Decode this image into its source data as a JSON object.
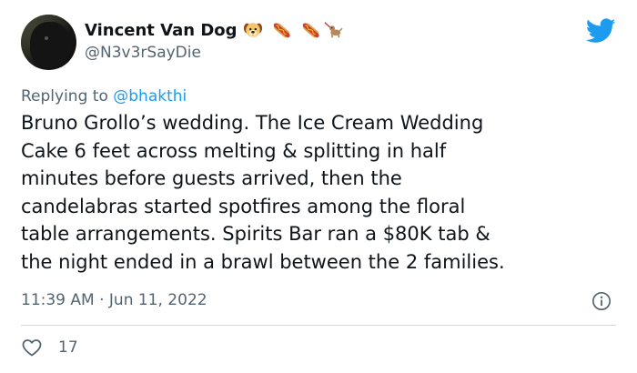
{
  "author": {
    "display_name": "Vincent Van Dog",
    "handle": "@N3v3rSayDie",
    "name_emojis": [
      "dog-face-emoji",
      "hotdog-emoji",
      "hotdog-emoji",
      "dog-on-leash-emoji"
    ]
  },
  "reply": {
    "prefix": "Replying to ",
    "mention": "@bhakthi"
  },
  "tweet": {
    "lines": [
      "Bruno Grollo’s wedding. The Ice Cream Wedding",
      "Cake 6 feet across melting & splitting in half",
      "minutes before guests arrived, then the",
      "candelabras started spotfires among the floral",
      "table arrangements. Spirits Bar ran a $80K tab &",
      "the night ended in a brawl between the 2 families."
    ],
    "timestamp": "11:39 AM · Jun 11, 2022",
    "like_count": "17"
  },
  "colors": {
    "brand": "#1d9bf0",
    "text": "#0f1419",
    "secondary": "#536471",
    "divider": "#cfd9de"
  }
}
